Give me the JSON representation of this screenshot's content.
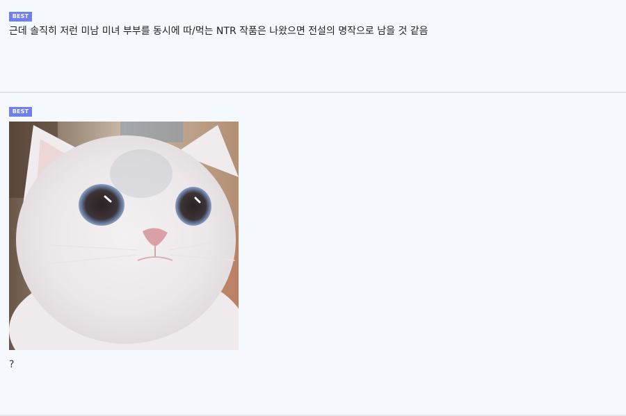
{
  "comments": [
    {
      "badge": "BEST",
      "text": "근데 솔직히 저런 미남 미녀 부부를 동시에 따/먹는 NTR 작품은 나왔으면 전설의 명작으로 남을 것 같음"
    },
    {
      "badge": "BEST",
      "image": "white-cat-photo",
      "text": "?"
    }
  ],
  "colors": {
    "background": "#f5f8fd",
    "badge": "#6f7ff0",
    "divider": "#dfe2e6"
  }
}
